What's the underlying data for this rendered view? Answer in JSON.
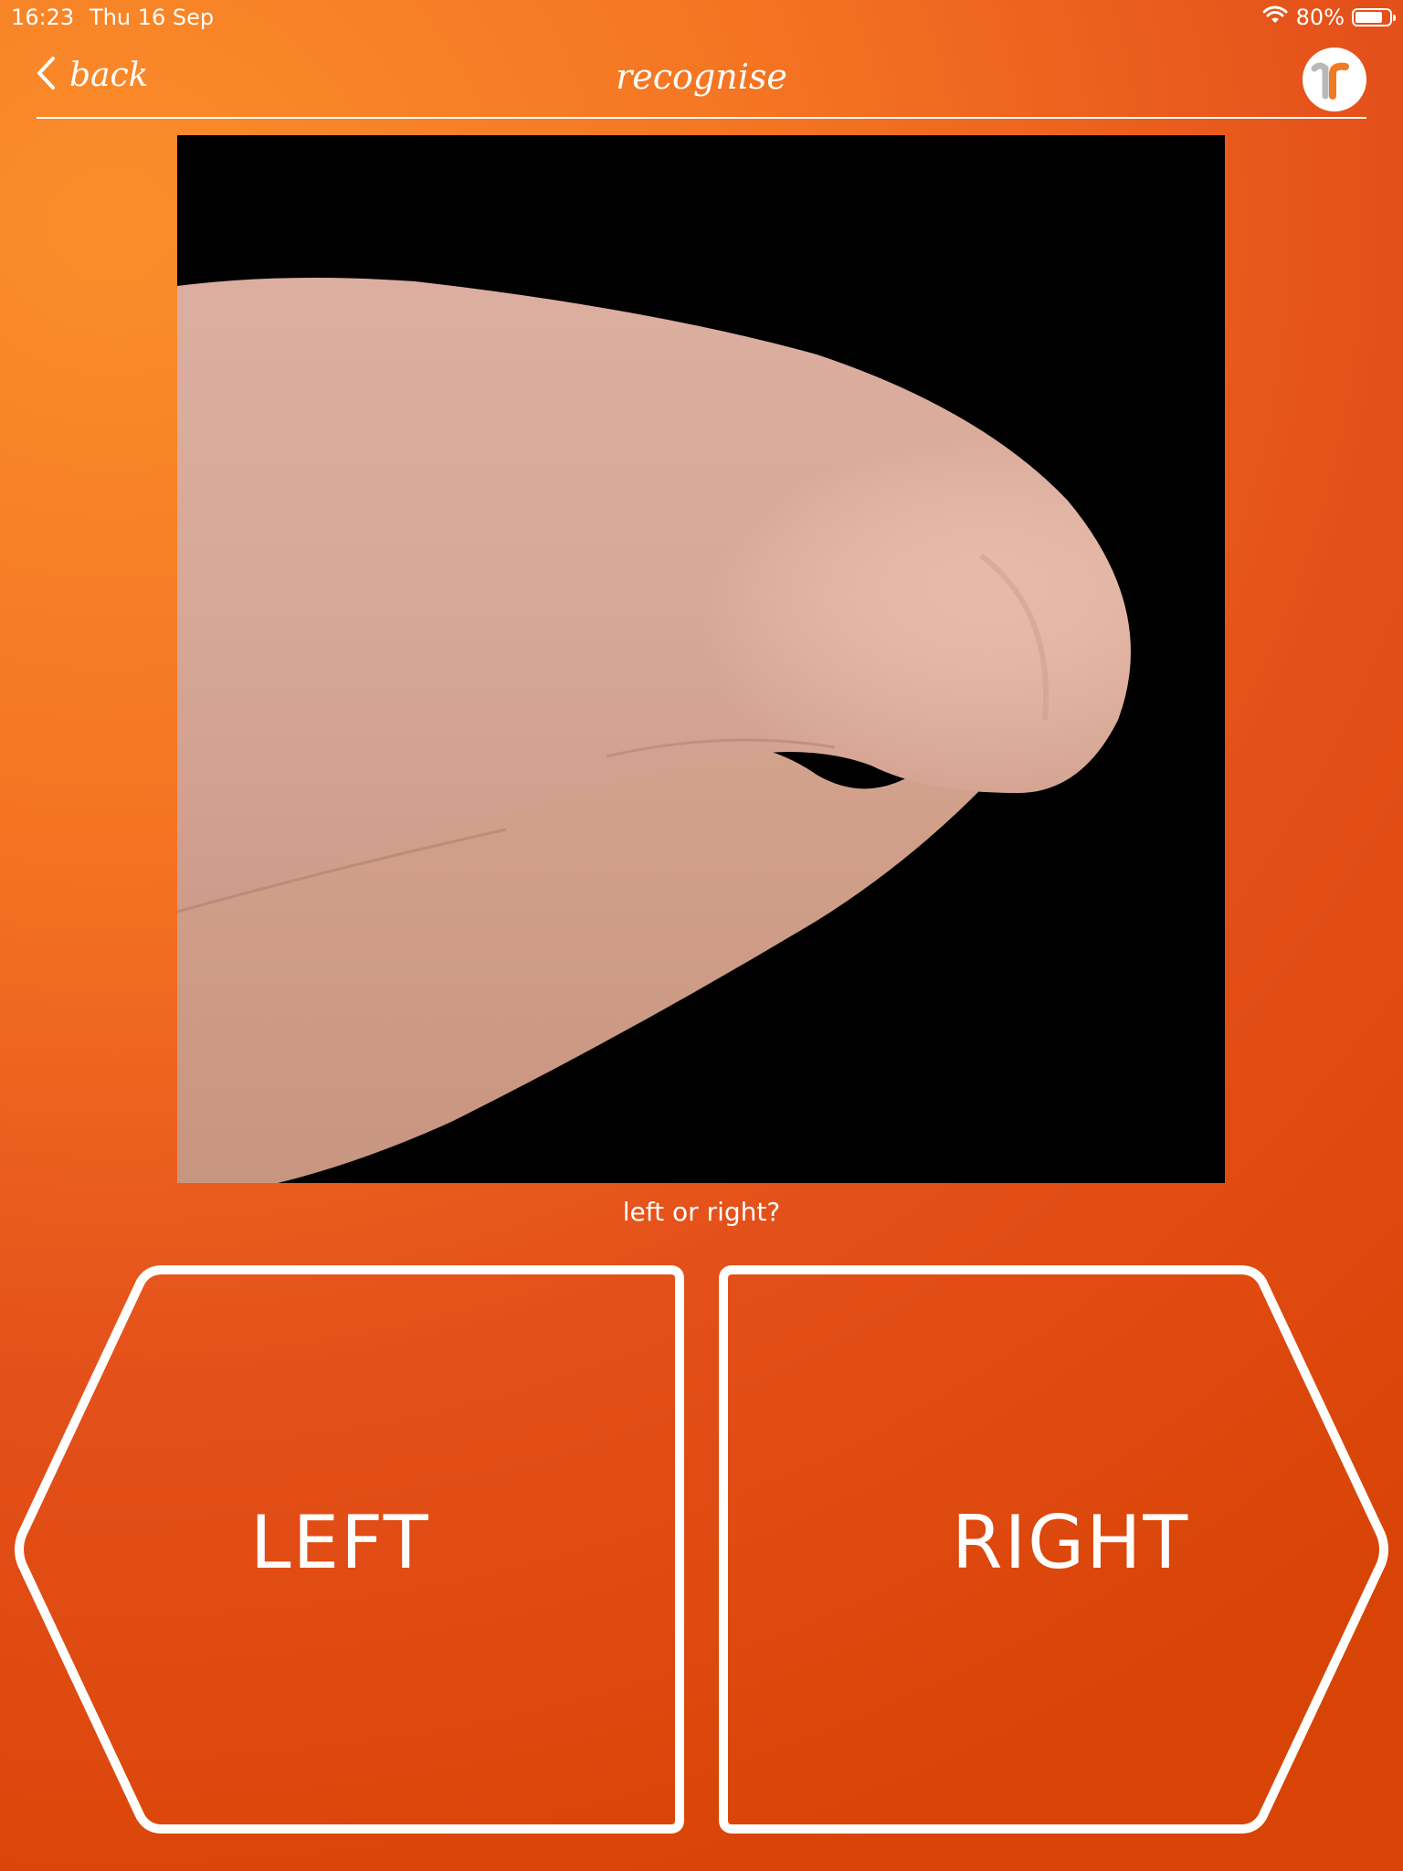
{
  "status_bar": {
    "time": "16:23",
    "date": "Thu 16 Sep",
    "battery_percent": "80%",
    "battery_level": 0.8,
    "wifi_icon": "wifi-icon"
  },
  "nav": {
    "back_label": "back",
    "title": "recognise",
    "logo_icon": "app-logo-icon"
  },
  "main": {
    "image_subject": "bent knee photo",
    "prompt": "left or right?"
  },
  "choices": {
    "left_label": "LEFT",
    "right_label": "RIGHT"
  },
  "colors": {
    "background_light": "#fb8e2b",
    "background_dark": "#d84406",
    "outline": "#ffffff"
  }
}
